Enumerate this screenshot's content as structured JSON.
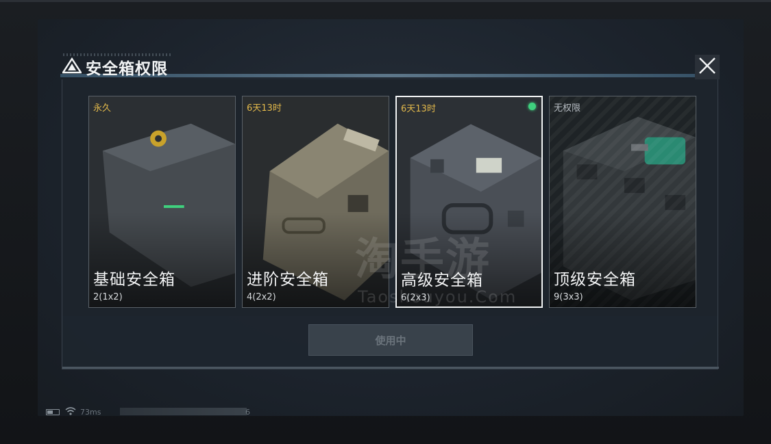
{
  "dialog": {
    "title": "安全箱权限",
    "close_icon": "close-icon",
    "logo_icon": "triangle-logo-icon"
  },
  "cards": [
    {
      "duration": "永久",
      "name": "基础安全箱",
      "capacity": "2(1x2)",
      "selected": false,
      "active": false,
      "color": "#3a3f45"
    },
    {
      "duration": "6天13时",
      "name": "进阶安全箱",
      "capacity": "4(2x2)",
      "selected": false,
      "active": false,
      "color": "#5b574a"
    },
    {
      "duration": "6天13时",
      "name": "高级安全箱",
      "capacity": "6(2x3)",
      "selected": true,
      "active": true,
      "color": "#3b4047"
    },
    {
      "duration": "无权限",
      "name": "顶级安全箱",
      "capacity": "9(3x3)",
      "selected": false,
      "active": false,
      "color": "#2a3030"
    }
  ],
  "use_button": {
    "label": "使用中"
  },
  "watermark": {
    "cn": "淘手游",
    "en": "Taoshouyou.Com"
  },
  "status": {
    "ping": "73ms",
    "number": "6"
  },
  "colors": {
    "duration_gold": "#e3b94b",
    "active_green": "#3fd17e",
    "selected_border": "#f2f4f5"
  }
}
